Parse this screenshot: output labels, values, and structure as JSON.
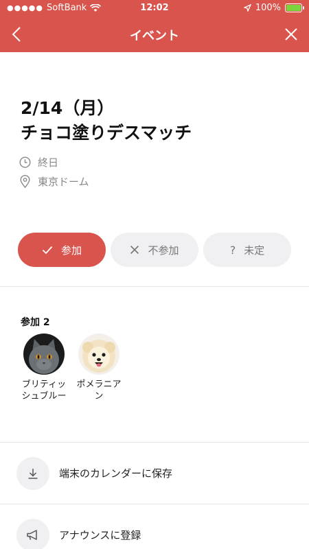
{
  "status_bar": {
    "carrier": "SoftBank",
    "time": "12:02",
    "battery": "100%"
  },
  "header": {
    "title": "イベント"
  },
  "event": {
    "date": "2/14（月）",
    "title": "チョコ塗りデスマッチ",
    "time_label": "終日",
    "location": "東京ドーム"
  },
  "rsvp": {
    "join_label": "参加",
    "decline_label": "不参加",
    "undecided_label": "未定",
    "selected": "join"
  },
  "participants": {
    "heading": "参加 2",
    "people": [
      {
        "name_line1": "ブリティッ",
        "name_line2": "シュブルー"
      },
      {
        "name_line1": "ポメラニア",
        "name_line2": "ン"
      }
    ]
  },
  "actions": {
    "save_calendar": "端末のカレンダーに保存",
    "announce": "アナウンスに登録"
  },
  "colors": {
    "accent": "#d9544c",
    "button_gray": "#f0f0f3",
    "meta_text": "#888888"
  }
}
